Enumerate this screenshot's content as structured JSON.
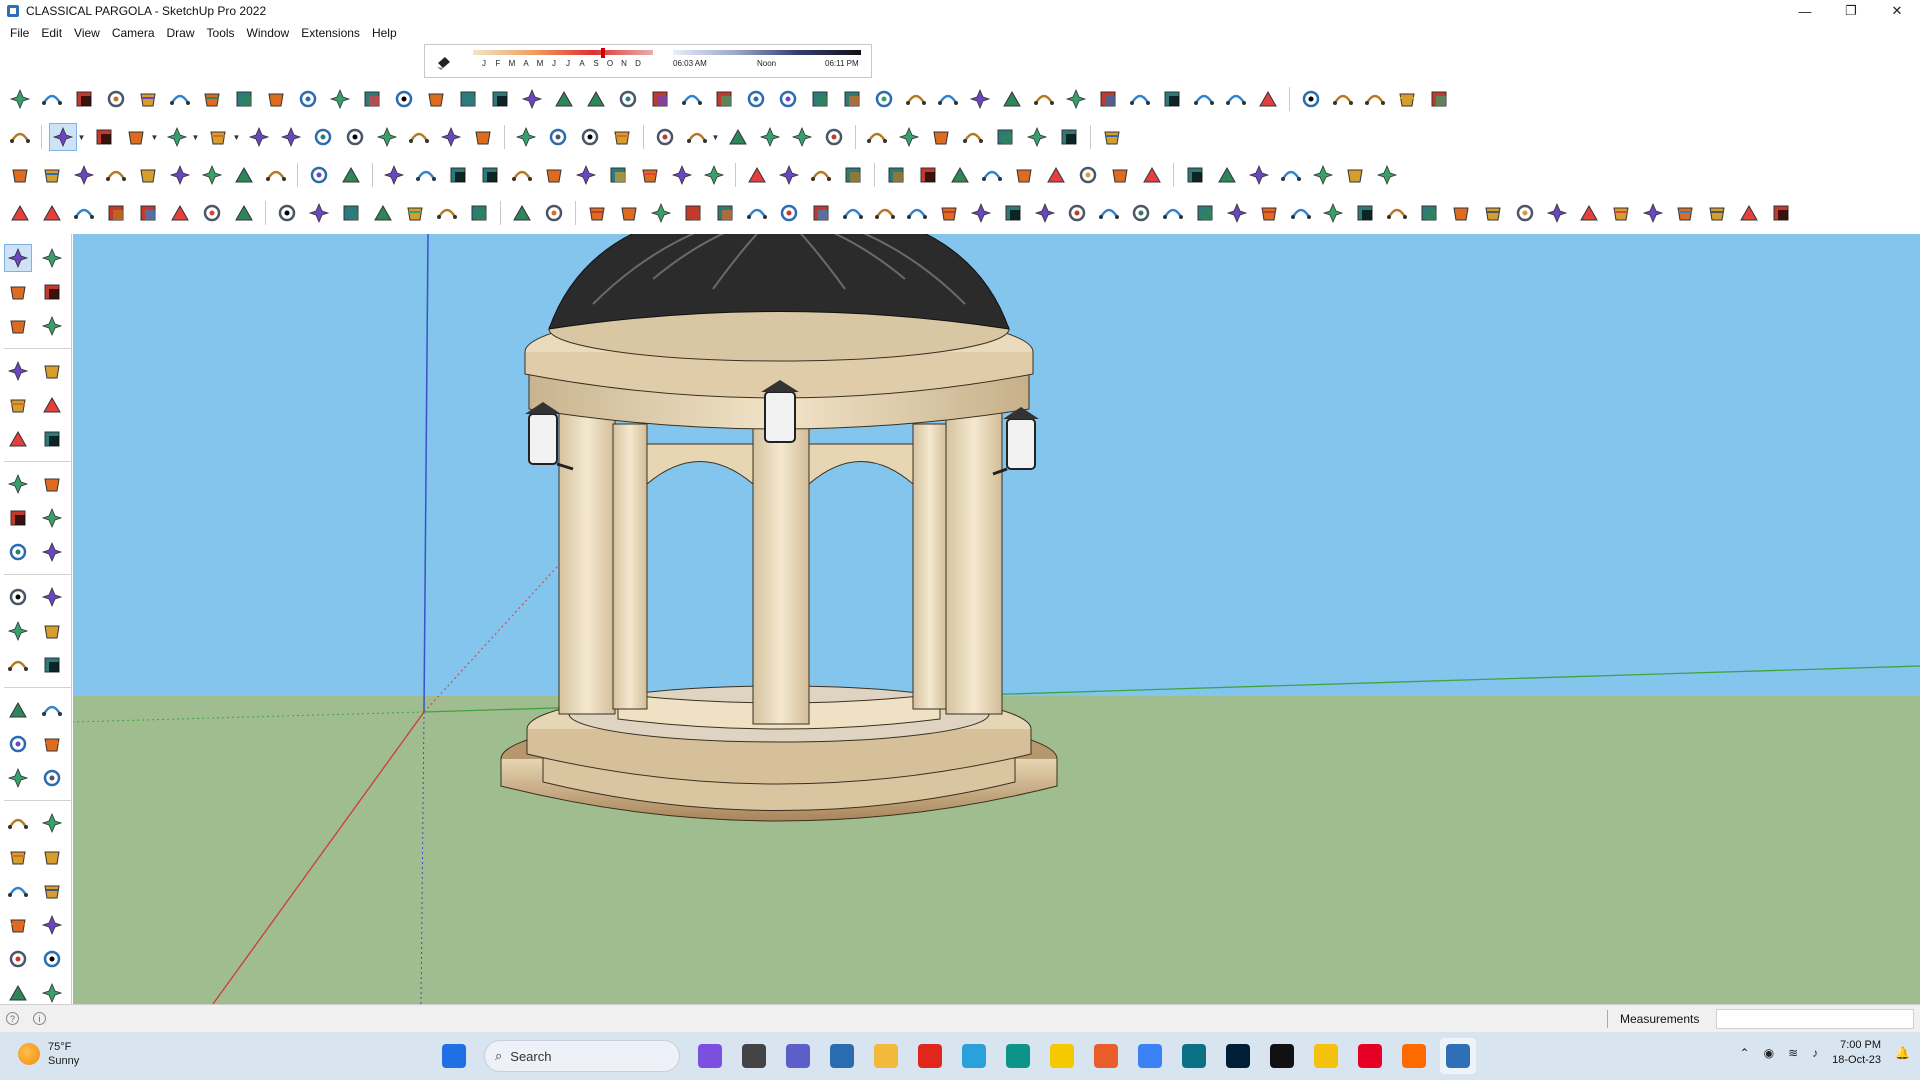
{
  "window": {
    "title": "CLASSICAL PARGOLA - SketchUp Pro 2022",
    "controls": {
      "minimize": "—",
      "maximize": "❐",
      "close": "✕"
    }
  },
  "menu": [
    "File",
    "Edit",
    "View",
    "Camera",
    "Draw",
    "Tools",
    "Window",
    "Extensions",
    "Help"
  ],
  "shadow_widget": {
    "months": [
      "J",
      "F",
      "M",
      "A",
      "M",
      "J",
      "J",
      "A",
      "S",
      "O",
      "N",
      "D"
    ],
    "times": {
      "start": "06:03 AM",
      "mid": "Noon",
      "end": "06:11 PM"
    }
  },
  "toolbars": {
    "row1": [
      "freehand-draw",
      "bezier-curve",
      "curve-edit",
      "intersect",
      "gear-shape",
      "cloud-shape",
      "loft",
      "shape-bender",
      "sphere",
      "extrude-path",
      "fillet",
      "chamfer",
      "line-split",
      "divide",
      "arch",
      "column",
      "railing",
      "stairs",
      "grid",
      "truss",
      "panel",
      "fence",
      "roof",
      "frame",
      "joist",
      "ramp",
      "wall",
      "window-tool",
      "door-tool",
      "mesh",
      "hatch",
      "rafter",
      "beam",
      "slab",
      "floor",
      "louver",
      "lattice",
      "spiral",
      "wave",
      "house",
      "house-outline",
      "garage",
      "roof-house",
      "home",
      "shed"
    ],
    "row2": [
      "zoom",
      "select",
      "eraser",
      "pencil",
      "arc",
      "rectangle",
      "push-pull",
      "follow-me",
      "move",
      "rotate",
      "scale",
      "tape-measure",
      "text-tool",
      "paint-bucket",
      "orbit",
      "pan",
      "zoom-in",
      "zoom-extents",
      "warehouse",
      "ext-warehouse",
      "layers",
      "components",
      "styles",
      "sandbox",
      "protrude",
      "blue-arrow",
      "red-arrow",
      "green-arrow",
      "brown-arrow",
      "orange-arrow",
      "pink-arrow",
      "color-pick"
    ],
    "row3": [
      "camera",
      "box",
      "box-open",
      "fur",
      "texture",
      "grid-box",
      "panel-box",
      "window-box",
      "component-group",
      "egg",
      "ruler",
      "rectangle-outline",
      "circle-outline",
      "polygon",
      "ellipse",
      "parallelogram",
      "arc-blue",
      "gear-blue",
      "lasso",
      "chain",
      "eraser-red",
      "tag-red",
      "material-blue",
      "material-split",
      "material-double",
      "leaf",
      "tree",
      "fingerprint",
      "brain",
      "shield",
      "shield-double",
      "shell",
      "refresh",
      "table-layout",
      "window-frame",
      "door-frame",
      "gallery",
      "slab-icon",
      "spline-1",
      "spline-2",
      "spline-3",
      "bow"
    ],
    "row4": [
      "sun-shape",
      "umbrella",
      "torus",
      "lamp",
      "triangle",
      "burst",
      "dome",
      "sphere-outline",
      "solid-shape",
      "solid-split",
      "square-grid",
      "cube-outline",
      "cube-solid",
      "ball",
      "ball-hatch",
      "cube-cursor",
      "plane-blue",
      "plane-light",
      "plane-yellow",
      "plane-green",
      "plane-red",
      "plane-flat",
      "lasso-orange",
      "square-red",
      "stack",
      "frame-corner",
      "wood-box",
      "gear-gray",
      "curve-hook",
      "node-spline",
      "plus-red",
      "plus-green",
      "cross-blue",
      "cone-green",
      "star-teal",
      "triangle-yellow",
      "coil-yellow",
      "coil-orange",
      "coil-gray",
      "arrows-blue",
      "cylinder",
      "magnet",
      "move-green",
      "copy-blue",
      "copy-red",
      "copy-gray",
      "hex",
      "spiral-gold",
      "screen-gray",
      "grid-gold",
      "grid-gold-2",
      "grid-gold-3",
      "scissors-red",
      "curve-dots",
      "layers-box"
    ]
  },
  "left_toolbar": [
    "select",
    "orbit",
    "paint-bucket",
    "eraser",
    "component",
    "tag",
    "line",
    "freehand",
    "rectangle",
    "rotated-rect",
    "circle",
    "polygon",
    "arc",
    "pie-arc",
    "two-point-arc",
    "three-point-arc",
    "move",
    "push-pull",
    "rotate",
    "follow-me",
    "scale",
    "offset",
    "tape-measure",
    "dimension",
    "protractor",
    "text",
    "axes",
    "3d-text",
    "orbit",
    "pan",
    "zoom",
    "zoom-window",
    "zoom-extents",
    "previous",
    "position-camera",
    "look-around",
    "walk",
    "section-plane",
    "warehouse",
    "extension-warehouse",
    "layers",
    "styles"
  ],
  "viewport": {
    "sky_color": "#84c5ee",
    "ground_color": "#9fbd8f",
    "axis_blue": "#3a52c4",
    "axis_green": "#3fa43f",
    "axis_red": "#d03a3a"
  },
  "statusbar": {
    "info_icons": [
      "?",
      "i"
    ],
    "measurements_label": "Measurements",
    "measurements_value": ""
  },
  "taskbar": {
    "weather": {
      "temp": "75°F",
      "condition": "Sunny"
    },
    "search_placeholder": "Search",
    "apps": [
      "windows-start",
      "copilot",
      "task-view",
      "meet",
      "calculator",
      "file-explorer",
      "opera",
      "telegram",
      "sketchup-launcher",
      "sticky-notes",
      "grammarly",
      "visual-studio",
      "layout-app",
      "photoshop",
      "vertex",
      "chrome",
      "pinterest",
      "soundcloud",
      "sketchup"
    ],
    "clock": {
      "time": "7:00 PM",
      "date": "18-Oct-23"
    }
  }
}
